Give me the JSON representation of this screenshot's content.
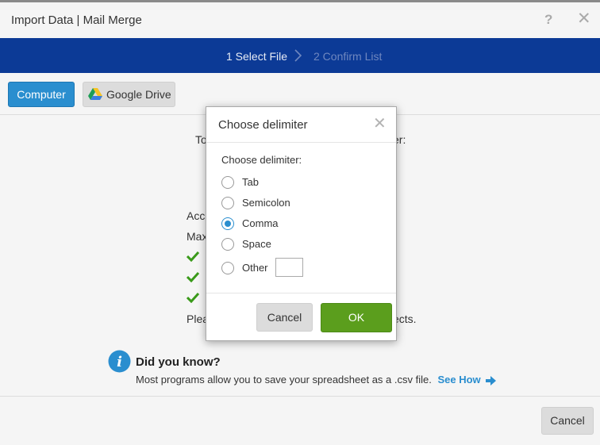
{
  "window": {
    "title": "Import Data | Mail Merge",
    "help_icon": "?",
    "close_icon": "✕"
  },
  "steps": [
    {
      "label": "1 Select File",
      "active": true
    },
    {
      "label": "2 Confirm List",
      "active": false
    }
  ],
  "source_buttons": {
    "computer": "Computer",
    "google_drive": "Google Drive"
  },
  "background_text": {
    "line_to": "To",
    "line_er": "er:",
    "accepted": "Acc",
    "max": "Max",
    "please": "Plea",
    "please_end": "ects."
  },
  "did_you_know": {
    "icon": "i",
    "title": "Did you know?",
    "text": "Most programs allow you to save your spreadsheet as a .csv file.",
    "link": "See How"
  },
  "footer": {
    "cancel_label": "Cancel"
  },
  "modal": {
    "title": "Choose delimiter",
    "close_icon": "✕",
    "label": "Choose delimiter:",
    "options": [
      {
        "label": "Tab",
        "checked": false
      },
      {
        "label": "Semicolon",
        "checked": false
      },
      {
        "label": "Comma",
        "checked": true
      },
      {
        "label": "Space",
        "checked": false
      },
      {
        "label": "Other",
        "checked": false
      }
    ],
    "other_value": "",
    "cancel_label": "Cancel",
    "ok_label": "OK"
  },
  "colors": {
    "step_bar": "#0c3a96",
    "primary_blue": "#2a8ecf",
    "ok_green": "#5b9e1d",
    "check_green": "#3a9a1a"
  }
}
